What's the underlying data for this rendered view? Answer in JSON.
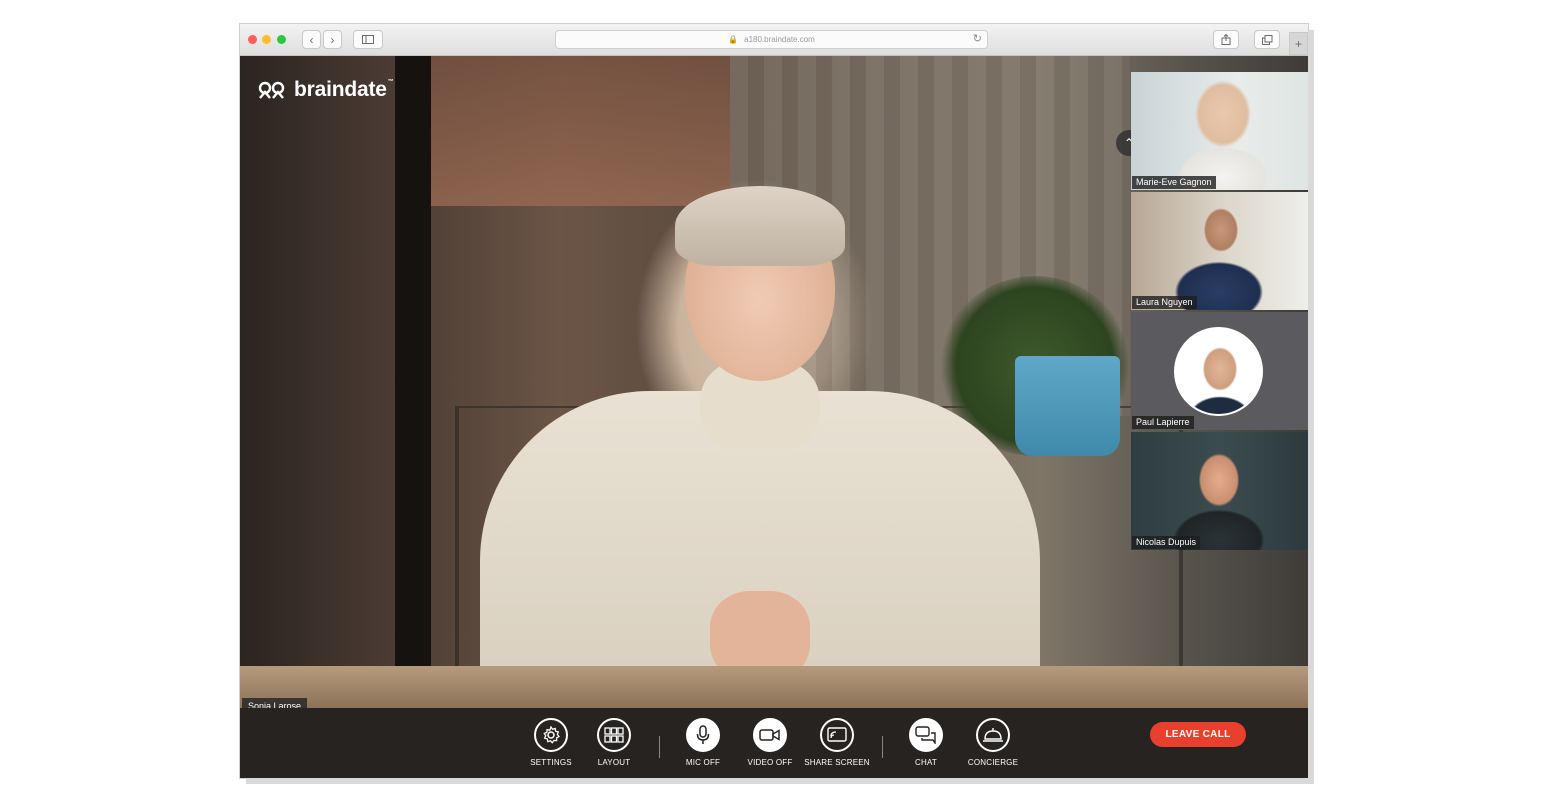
{
  "browser": {
    "url": "a180.braindate.com",
    "back_icon": "chevron-left-icon",
    "forward_icon": "chevron-right-icon",
    "sidebar_icon": "sidebar-icon",
    "reload_icon": "reload-icon",
    "share_icon": "share-icon",
    "tabs_icon": "tabs-icon",
    "new_tab_label": "+"
  },
  "app": {
    "logo_text": "braindate",
    "logo_tm": "™",
    "main_speaker": "Sonia Larose"
  },
  "participants": [
    {
      "name": "Marie-Eve Gagnon"
    },
    {
      "name": "Laura Nguyen"
    },
    {
      "name": "Paul Lapierre"
    },
    {
      "name": "Nicolas Dupuis"
    }
  ],
  "toolbar": {
    "settings": "SETTINGS",
    "layout": "LAYOUT",
    "mic_off": "MIC OFF",
    "video_off": "VIDEO OFF",
    "share_screen": "SHARE SCREEN",
    "chat": "CHAT",
    "concierge": "CONCIERGE",
    "leave_call": "LEAVE CALL"
  },
  "colors": {
    "leave_call": "#e9402e",
    "toolbar_bg": "#262321"
  }
}
